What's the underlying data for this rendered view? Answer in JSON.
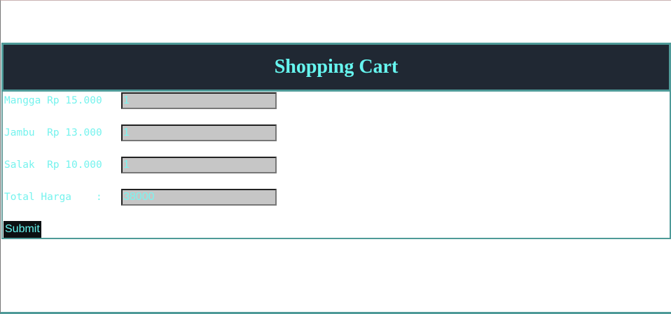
{
  "header": {
    "title": "Shopping Cart"
  },
  "items": [
    {
      "label": "Mangga Rp 15.000",
      "value": "1"
    },
    {
      "label": "Jambu  Rp 13.000",
      "value": "1"
    },
    {
      "label": "Salak  Rp 10.000",
      "value": "1"
    }
  ],
  "total": {
    "label": "Total Harga    :",
    "value": "38000"
  },
  "submit_label": "Submit",
  "colors": {
    "header_bg": "#202833",
    "accent": "#66f5ef",
    "border": "#4e9a98"
  }
}
